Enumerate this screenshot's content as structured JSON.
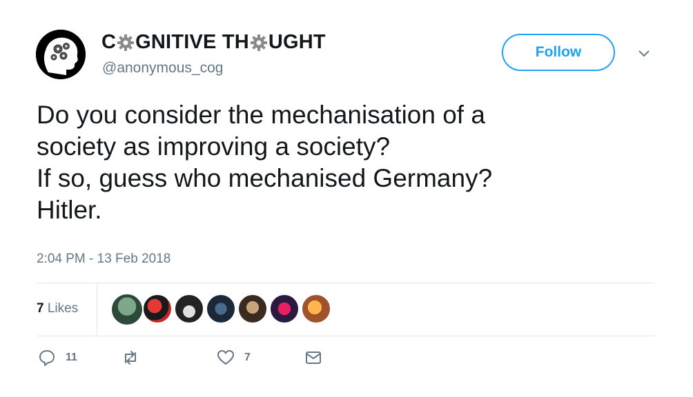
{
  "user": {
    "name_part1": "C",
    "name_part2": "GNITIVE TH",
    "name_part3": "UGHT",
    "handle": "@anonymous_cog"
  },
  "follow": {
    "label": "Follow"
  },
  "tweet": {
    "lines": [
      "Do you consider the mechanisation of a",
      "society as improving a society?",
      "If so, guess who mechanised Germany?",
      "Hitler."
    ],
    "timestamp": "2:04 PM - 13 Feb 2018"
  },
  "likes": {
    "count": "7",
    "label": "Likes"
  },
  "actions": {
    "reply_count": "11",
    "retweet_count": "",
    "like_count": "7"
  },
  "colors": {
    "accent": "#1da1f2",
    "muted": "#657786",
    "divider": "#e1e8ed"
  }
}
